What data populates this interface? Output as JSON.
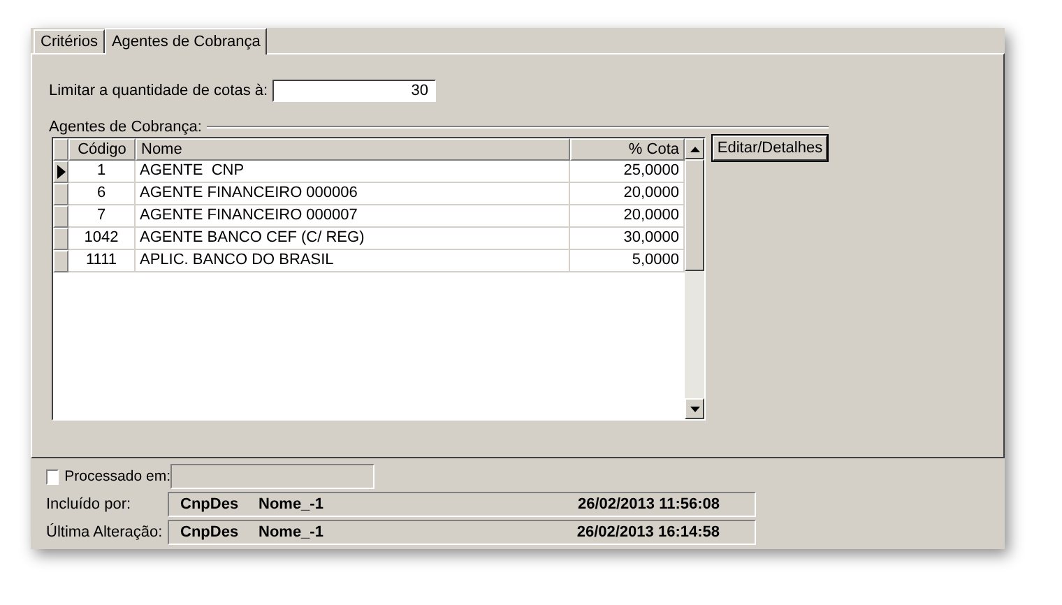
{
  "tabs": [
    {
      "label": "Critérios",
      "selected": false
    },
    {
      "label": "Agentes de Cobrança",
      "selected": true
    }
  ],
  "limit": {
    "label": "Limitar a quantidade de cotas à:",
    "value": "30"
  },
  "group": {
    "title": "Agentes de Cobrança:"
  },
  "table": {
    "columns": [
      "Código",
      "Nome",
      "% Cota"
    ],
    "rows": [
      {
        "cells": [
          "1",
          "AGENTE  CNP",
          "25,0000"
        ],
        "selected": true
      },
      {
        "cells": [
          "6",
          "AGENTE FINANCEIRO 000006",
          "20,0000"
        ],
        "selected": false
      },
      {
        "cells": [
          "7",
          "AGENTE FINANCEIRO 000007",
          "20,0000"
        ],
        "selected": false
      },
      {
        "cells": [
          "1042",
          "AGENTE BANCO CEF (C/ REG)",
          "30,0000"
        ],
        "selected": false
      },
      {
        "cells": [
          "1111",
          "APLIC. BANCO DO BRASIL",
          "5,0000"
        ],
        "selected": false
      }
    ]
  },
  "edit_button": "Editar/Detalhes",
  "processed": {
    "label": "Processado em:",
    "checked": false
  },
  "audit": [
    {
      "label": "Incluído por:",
      "user": "CnpDes",
      "name": "Nome_-1",
      "date": "26/02/2013 11:56:08"
    },
    {
      "label": "Última Alteração:",
      "user": "CnpDes",
      "name": "Nome_-1",
      "date": "26/02/2013 16:14:58"
    }
  ]
}
